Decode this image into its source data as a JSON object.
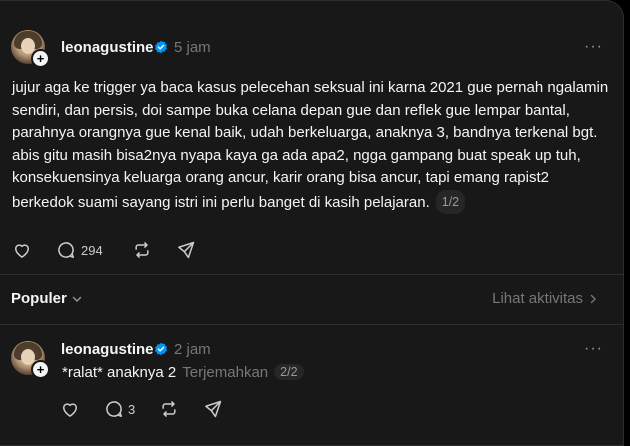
{
  "post": {
    "username": "leonagustine",
    "time": "5 jam",
    "more_label": "···",
    "paragraph1": "jujur aga ke trigger ya baca kasus pelecehan seksual ini karna 2021 gue pernah ngalamin sendiri, dan persis, doi sampe buka celana depan gue dan reflek gue lempar bantal, parahnya orangnya gue kenal baik, udah berkeluarga, anaknya 3, bandnya terkenal bgt.",
    "paragraph2": "abis gitu masih bisa2nya nyapa kaya ga ada apa2, ngga gampang buat speak up tuh, konsekuensinya keluarga orang ancur, karir orang bisa ancur, tapi emang rapist2 berkedok suami sayang istri ini perlu banget di kasih pelajaran.",
    "pager": "1/2",
    "reply_count": "294",
    "icons": [
      "heart-icon",
      "comment-icon",
      "repost-icon",
      "share-icon"
    ]
  },
  "replies_header": {
    "sort_label": "Populer",
    "activity_label": "Lihat aktivitas"
  },
  "reply": {
    "username": "leonagustine",
    "time": "2 jam",
    "text": "*ralat* anaknya 2",
    "translate_label": "Terjemahkan",
    "pager": "2/2",
    "reply_count": "3",
    "more_label": "···"
  },
  "colors": {
    "background": "#000000",
    "panel": "#181818",
    "text": "#f3f5f7",
    "muted": "#777777",
    "verified": "#0095f6"
  }
}
